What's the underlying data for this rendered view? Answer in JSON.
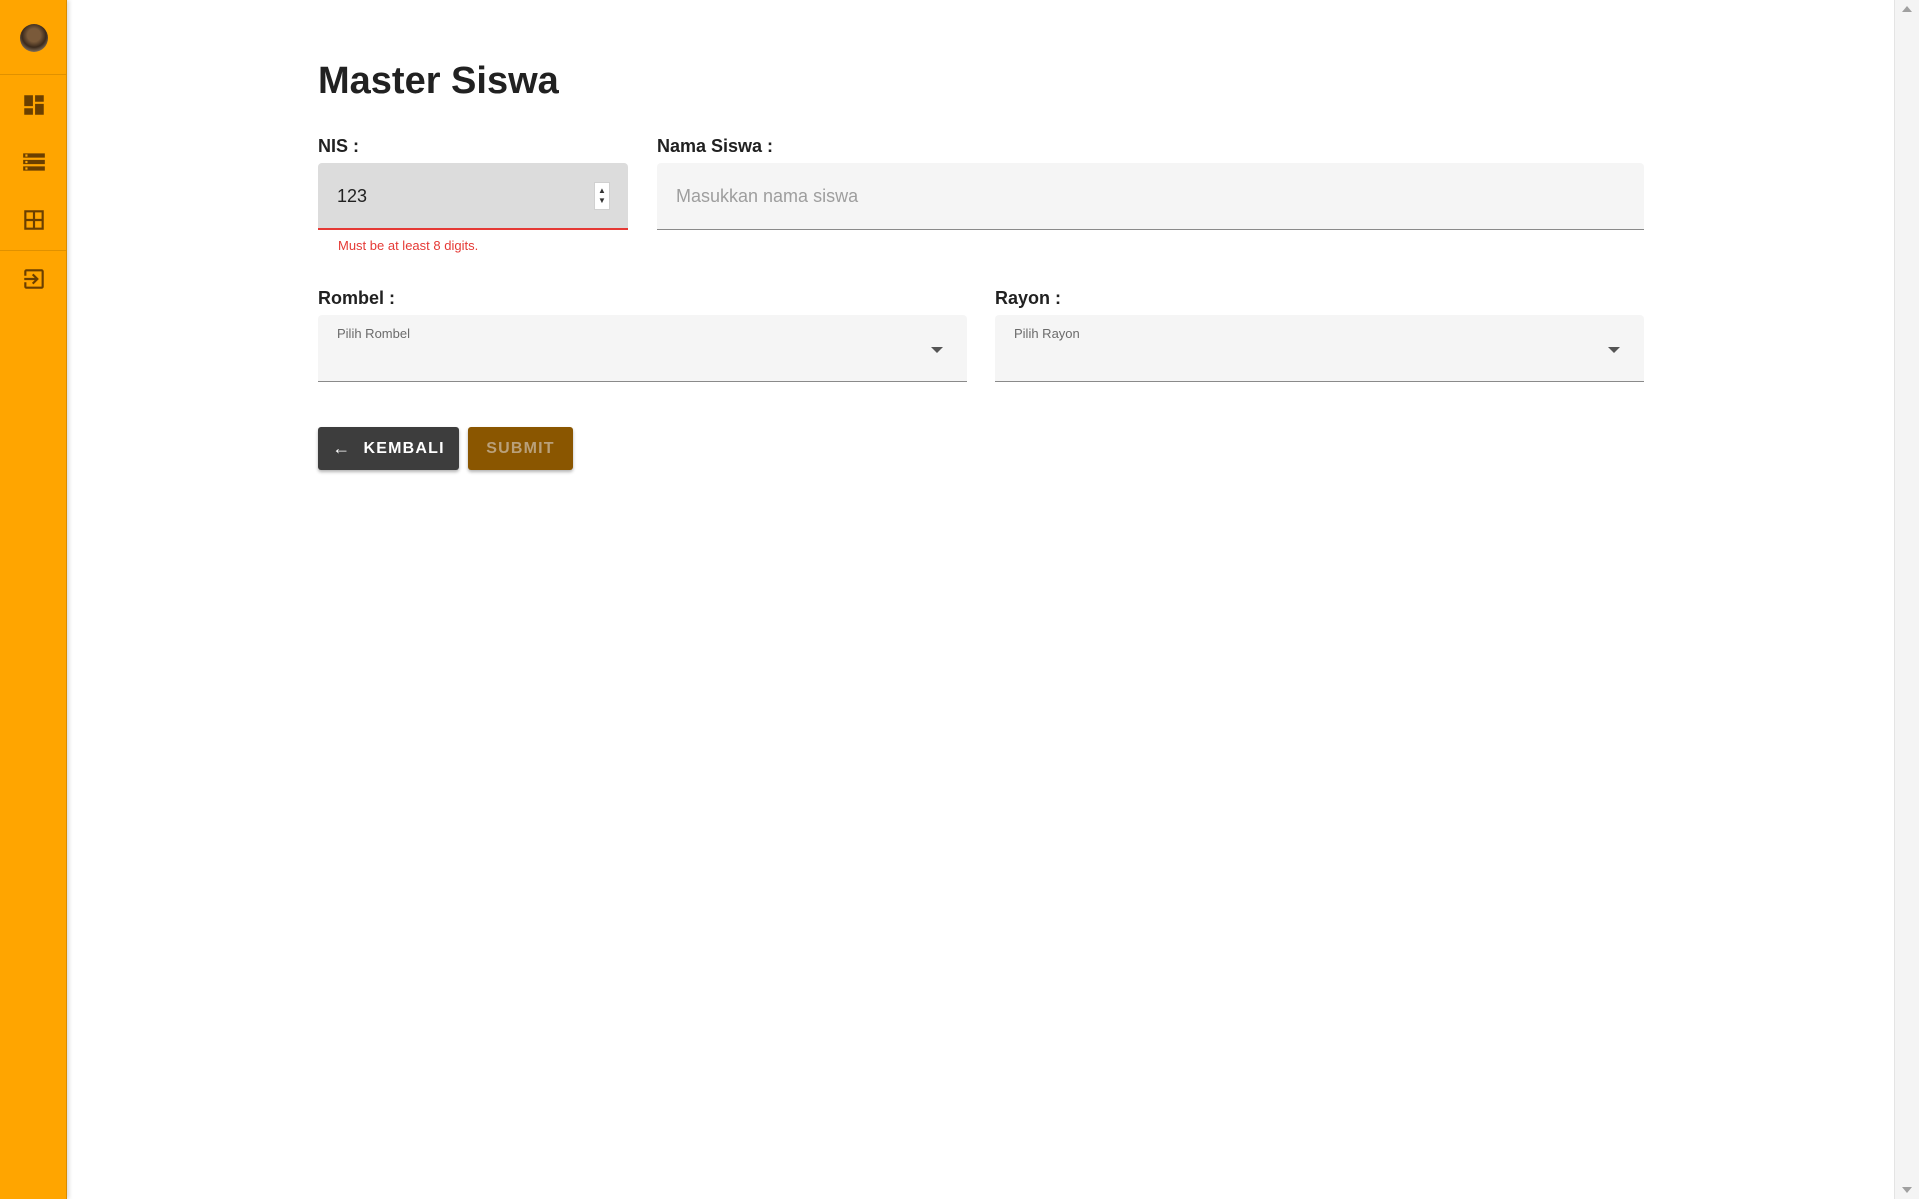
{
  "page": {
    "title": "Master Siswa"
  },
  "sidebar": {
    "accent": "#ffa500",
    "icon_color": "#6a3f00",
    "items": [
      {
        "icon": "dashboard-icon"
      },
      {
        "icon": "storage-icon"
      },
      {
        "icon": "table-icon"
      },
      {
        "icon": "logout-icon"
      }
    ]
  },
  "form": {
    "nis": {
      "label": "NIS :",
      "value": "123",
      "error": "Must be at least 8 digits."
    },
    "nama": {
      "label": "Nama Siswa :",
      "placeholder": "Masukkan nama siswa",
      "value": ""
    },
    "rombel": {
      "label": "Rombel :",
      "placeholder": "Pilih Rombel"
    },
    "rayon": {
      "label": "Rayon :",
      "placeholder": "Pilih Rayon"
    }
  },
  "buttons": {
    "back_label": "KEMBALI",
    "submit_label": "SUBMIT"
  },
  "colors": {
    "error": "#e53935",
    "back_button": "#3d3d3d",
    "submit_button": "#8a5600"
  }
}
